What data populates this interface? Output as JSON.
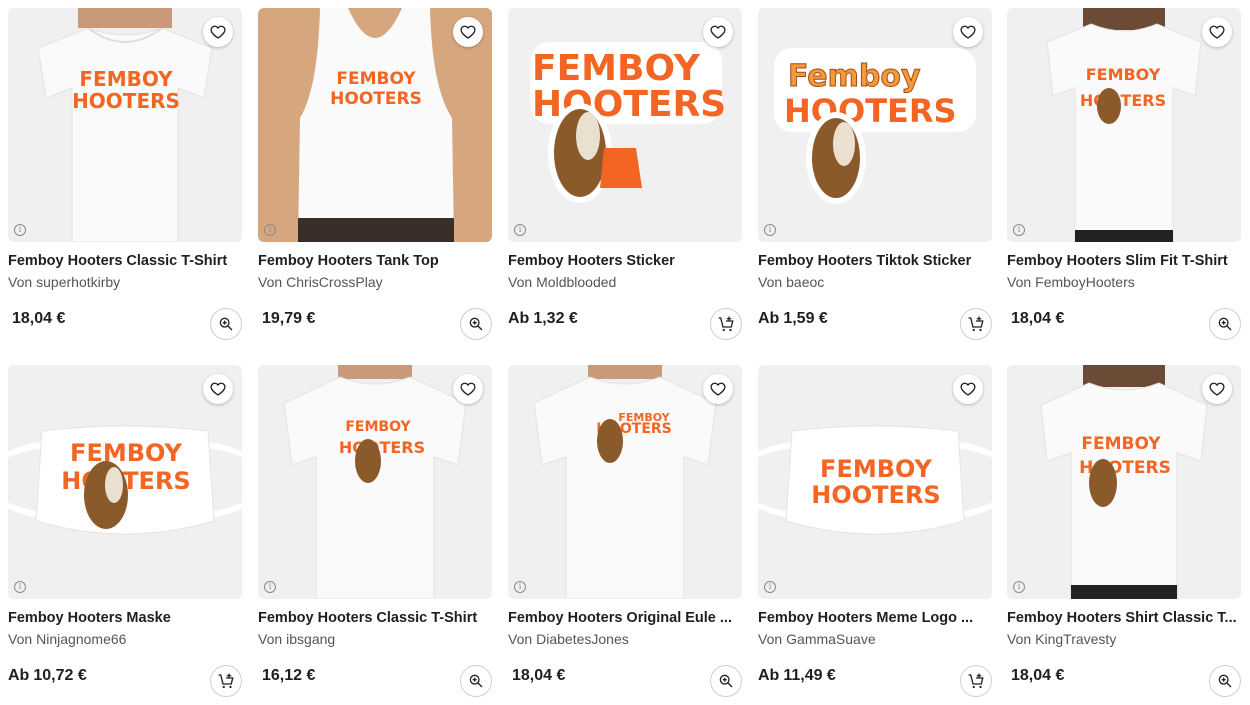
{
  "products": [
    {
      "title": "Femboy Hooters Classic T-Shirt",
      "by": "Von",
      "artist": "superhotkirby",
      "prefix": "",
      "price": "18,04 €",
      "action": "zoom-icon",
      "art": "tshirt-woman"
    },
    {
      "title": "Femboy Hooters Tank Top",
      "by": "Von",
      "artist": "ChrisCrossPlay",
      "prefix": "",
      "price": "19,79 €",
      "action": "zoom-icon",
      "art": "tank-top"
    },
    {
      "title": "Femboy Hooters Sticker",
      "by": "Von",
      "artist": "Moldblooded",
      "prefix": "Ab",
      "price": "1,32 €",
      "action": "cart-add-icon",
      "art": "sticker-owl"
    },
    {
      "title": "Femboy Hooters Tiktok Sticker",
      "by": "Von",
      "artist": "baeoc",
      "prefix": "Ab",
      "price": "1,59 €",
      "action": "cart-add-icon",
      "art": "sticker-tiktok"
    },
    {
      "title": "Femboy Hooters Slim Fit T-Shirt",
      "by": "Von",
      "artist": "FemboyHooters",
      "prefix": "",
      "price": "18,04 €",
      "action": "zoom-icon",
      "art": "tshirt-woman-small"
    },
    {
      "title": "Femboy Hooters Maske",
      "by": "Von",
      "artist": "Ninjagnome66",
      "prefix": "Ab",
      "price": "10,72 €",
      "action": "cart-add-icon",
      "art": "mask-owl"
    },
    {
      "title": "Femboy Hooters Classic T-Shirt",
      "by": "Von",
      "artist": "ibsgang",
      "prefix": "",
      "price": "16,12 €",
      "action": "zoom-icon",
      "art": "tshirt-man"
    },
    {
      "title": "Femboy Hooters Original Eule ...",
      "by": "Von",
      "artist": "DiabetesJones",
      "prefix": "",
      "price": "18,04 €",
      "action": "zoom-icon",
      "art": "tshirt-man-2"
    },
    {
      "title": "Femboy Hooters Meme Logo ...",
      "by": "Von",
      "artist": "GammaSuave",
      "prefix": "Ab",
      "price": "11,49 €",
      "action": "cart-add-icon",
      "art": "mask-text"
    },
    {
      "title": "Femboy Hooters Shirt Classic T...",
      "by": "Von",
      "artist": "KingTravesty",
      "prefix": "",
      "price": "18,04 €",
      "action": "zoom-icon",
      "art": "tshirt-woman-3"
    }
  ],
  "design_text": {
    "line1": "FEMBOY",
    "line2": "HOOTERS",
    "line1_alt": "Femboy"
  },
  "colors": {
    "accent": "#f26522",
    "owl": "#8b5a2b"
  },
  "icons": {
    "favorite": "heart-icon",
    "info": "info-icon"
  }
}
